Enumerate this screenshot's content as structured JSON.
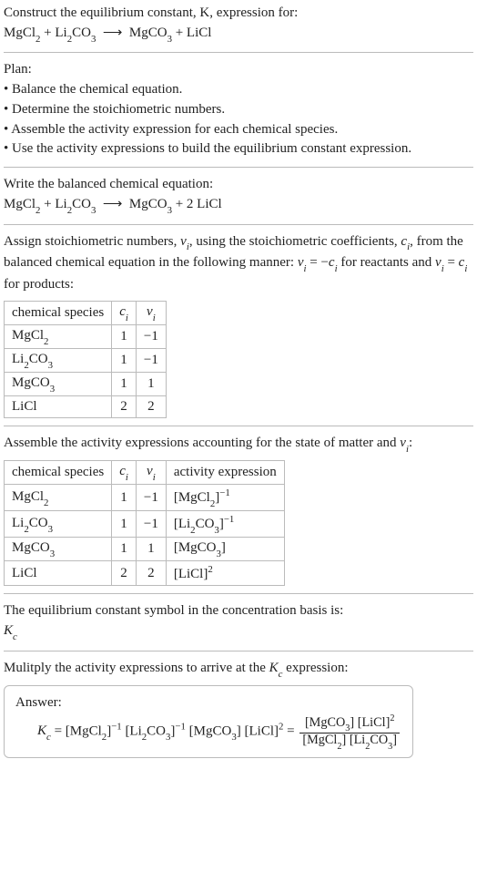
{
  "intro": {
    "line1": "Construct the equilibrium constant, K, expression for:",
    "equation_html": "MgCl<sub>2</sub> + Li<sub>2</sub>CO<sub>3</sub> &nbsp;⟶&nbsp; MgCO<sub>3</sub> + LiCl"
  },
  "plan": {
    "heading": "Plan:",
    "items": [
      "Balance the chemical equation.",
      "Determine the stoichiometric numbers.",
      "Assemble the activity expression for each chemical species.",
      "Use the activity expressions to build the equilibrium constant expression."
    ]
  },
  "balanced": {
    "heading": "Write the balanced chemical equation:",
    "equation_html": "MgCl<sub>2</sub> + Li<sub>2</sub>CO<sub>3</sub> &nbsp;⟶&nbsp; MgCO<sub>3</sub> + 2 LiCl"
  },
  "stoich_intro_html": "Assign stoichiometric numbers, <span class='it'>ν<sub>i</sub></span>, using the stoichiometric coefficients, <span class='it'>c<sub>i</sub></span>, from the balanced chemical equation in the following manner: <span class='it'>ν<sub>i</sub></span> = −<span class='it'>c<sub>i</sub></span> for reactants and <span class='it'>ν<sub>i</sub></span> = <span class='it'>c<sub>i</sub></span> for products:",
  "table1": {
    "headers": [
      "chemical species",
      "c_i",
      "ν_i"
    ],
    "headers_html": [
      "chemical species",
      "<span class='it'>c<sub>i</sub></span>",
      "<span class='it'>ν<sub>i</sub></span>"
    ],
    "rows": [
      {
        "species_html": "MgCl<sub>2</sub>",
        "ci": "1",
        "vi": "−1"
      },
      {
        "species_html": "Li<sub>2</sub>CO<sub>3</sub>",
        "ci": "1",
        "vi": "−1"
      },
      {
        "species_html": "MgCO<sub>3</sub>",
        "ci": "1",
        "vi": "1"
      },
      {
        "species_html": "LiCl",
        "ci": "2",
        "vi": "2"
      }
    ]
  },
  "activity_intro_html": "Assemble the activity expressions accounting for the state of matter and <span class='it'>ν<sub>i</sub></span>:",
  "table2": {
    "headers_html": [
      "chemical species",
      "<span class='it'>c<sub>i</sub></span>",
      "<span class='it'>ν<sub>i</sub></span>",
      "activity expression"
    ],
    "rows": [
      {
        "species_html": "MgCl<sub>2</sub>",
        "ci": "1",
        "vi": "−1",
        "act_html": "[MgCl<sub>2</sub>]<sup>−1</sup>"
      },
      {
        "species_html": "Li<sub>2</sub>CO<sub>3</sub>",
        "ci": "1",
        "vi": "−1",
        "act_html": "[Li<sub>2</sub>CO<sub>3</sub>]<sup>−1</sup>"
      },
      {
        "species_html": "MgCO<sub>3</sub>",
        "ci": "1",
        "vi": "1",
        "act_html": "[MgCO<sub>3</sub>]"
      },
      {
        "species_html": "LiCl",
        "ci": "2",
        "vi": "2",
        "act_html": "[LiCl]<sup>2</sup>"
      }
    ]
  },
  "kc_symbol_intro": "The equilibrium constant symbol in the concentration basis is:",
  "kc_symbol_html": "<span class='it'>K<sub>c</sub></span>",
  "multiply_intro_html": "Mulitply the activity expressions to arrive at the <span class='it'>K<sub>c</sub></span> expression:",
  "answer": {
    "label": "Answer:",
    "expr_html": "<span class='it'>K<sub>c</sub></span> = [MgCl<sub>2</sub>]<sup>−1</sup> [Li<sub>2</sub>CO<sub>3</sub>]<sup>−1</sup> [MgCO<sub>3</sub>] [LiCl]<sup>2</sup> = <span class='frac'><span class='num'>[MgCO<sub>3</sub>] [LiCl]<sup>2</sup></span><span class='den'>[MgCl<sub>2</sub>] [Li<sub>2</sub>CO<sub>3</sub>]</span></span>"
  },
  "chart_data": {
    "type": "table",
    "tables": [
      {
        "title": "Stoichiometric numbers",
        "columns": [
          "chemical species",
          "c_i",
          "ν_i"
        ],
        "rows": [
          [
            "MgCl2",
            1,
            -1
          ],
          [
            "Li2CO3",
            1,
            -1
          ],
          [
            "MgCO3",
            1,
            1
          ],
          [
            "LiCl",
            2,
            2
          ]
        ]
      },
      {
        "title": "Activity expressions",
        "columns": [
          "chemical species",
          "c_i",
          "ν_i",
          "activity expression"
        ],
        "rows": [
          [
            "MgCl2",
            1,
            -1,
            "[MgCl2]^-1"
          ],
          [
            "Li2CO3",
            1,
            -1,
            "[Li2CO3]^-1"
          ],
          [
            "MgCO3",
            1,
            1,
            "[MgCO3]"
          ],
          [
            "LiCl",
            2,
            2,
            "[LiCl]^2"
          ]
        ]
      }
    ]
  }
}
